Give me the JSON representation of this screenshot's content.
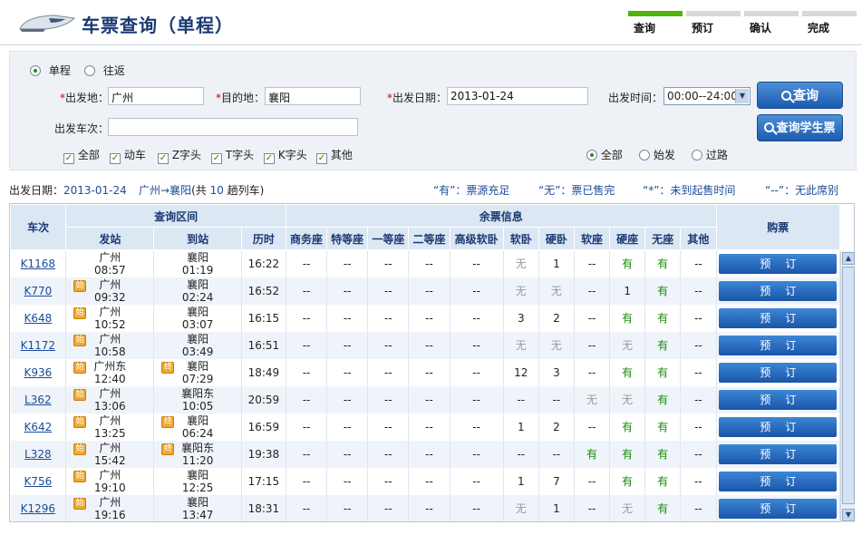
{
  "header": {
    "title": "车票查询（单程）",
    "steps": [
      "查询",
      "预订",
      "确认",
      "完成"
    ]
  },
  "search": {
    "trip_single": "单程",
    "trip_round": "往返",
    "from_label": "出发地：",
    "from_value": "广州",
    "to_label": "目的地：",
    "to_value": "襄阳",
    "date_label": "出发日期：",
    "date_value": "2013-01-24",
    "time_label": "出发时间：",
    "time_value": "00:00--24:00",
    "train_no_label": "出发车次：",
    "query_button": "查询",
    "student_button": "查询学生票",
    "train_types": [
      "全部",
      "动车",
      "Z字头",
      "T字头",
      "K字头",
      "其他"
    ],
    "station_filters": [
      "全部",
      "始发",
      "过路"
    ]
  },
  "summary": {
    "date_label": "出发日期：",
    "date": "2013-01-24",
    "route": "广州→襄阳",
    "count_pre": "(共 ",
    "count": "10",
    "count_post": " 趟列车)",
    "legend": [
      "“有”：票源充足",
      "“无”：票已售完",
      "“*”：未到起售时间",
      "“--”：无此席别"
    ]
  },
  "table": {
    "h_train": "车次",
    "h_section": "查询区间",
    "h_tickets": "余票信息",
    "h_buy": "购票",
    "h_from": "发站",
    "h_to": "到站",
    "h_dur": "历时",
    "seat_headers": [
      "商务座",
      "特等座",
      "一等座",
      "二等座",
      "高级软卧",
      "软卧",
      "硬卧",
      "软座",
      "硬座",
      "无座",
      "其他"
    ],
    "book_label": "预订",
    "rows": [
      {
        "train": "K1168",
        "from": "广州",
        "dep": "08:57",
        "to": "襄阳",
        "arr": "01:19",
        "dur": "16:22",
        "from_tag": "",
        "to_tag": "",
        "seats": [
          "--",
          "--",
          "--",
          "--",
          "--",
          "无",
          "1",
          "--",
          "有",
          "有",
          "--"
        ]
      },
      {
        "train": "K770",
        "from": "广州",
        "dep": "09:32",
        "to": "襄阳",
        "arr": "02:24",
        "dur": "16:52",
        "from_tag": "始",
        "to_tag": "",
        "seats": [
          "--",
          "--",
          "--",
          "--",
          "--",
          "无",
          "无",
          "--",
          "1",
          "有",
          "--"
        ]
      },
      {
        "train": "K648",
        "from": "广州",
        "dep": "10:52",
        "to": "襄阳",
        "arr": "03:07",
        "dur": "16:15",
        "from_tag": "始",
        "to_tag": "",
        "seats": [
          "--",
          "--",
          "--",
          "--",
          "--",
          "3",
          "2",
          "--",
          "有",
          "有",
          "--"
        ]
      },
      {
        "train": "K1172",
        "from": "广州",
        "dep": "10:58",
        "to": "襄阳",
        "arr": "03:49",
        "dur": "16:51",
        "from_tag": "始",
        "to_tag": "",
        "seats": [
          "--",
          "--",
          "--",
          "--",
          "--",
          "无",
          "无",
          "--",
          "无",
          "有",
          "--"
        ]
      },
      {
        "train": "K936",
        "from": "广州东",
        "dep": "12:40",
        "to": "襄阳",
        "arr": "07:29",
        "dur": "18:49",
        "from_tag": "始",
        "to_tag": "终",
        "seats": [
          "--",
          "--",
          "--",
          "--",
          "--",
          "12",
          "3",
          "--",
          "有",
          "有",
          "--"
        ]
      },
      {
        "train": "L362",
        "from": "广州",
        "dep": "13:06",
        "to": "襄阳东",
        "arr": "10:05",
        "dur": "20:59",
        "from_tag": "始",
        "to_tag": "",
        "seats": [
          "--",
          "--",
          "--",
          "--",
          "--",
          "--",
          "--",
          "无",
          "无",
          "有",
          "--"
        ]
      },
      {
        "train": "K642",
        "from": "广州",
        "dep": "13:25",
        "to": "襄阳",
        "arr": "06:24",
        "dur": "16:59",
        "from_tag": "始",
        "to_tag": "终",
        "seats": [
          "--",
          "--",
          "--",
          "--",
          "--",
          "1",
          "2",
          "--",
          "有",
          "有",
          "--"
        ]
      },
      {
        "train": "L328",
        "from": "广州",
        "dep": "15:42",
        "to": "襄阳东",
        "arr": "11:20",
        "dur": "19:38",
        "from_tag": "始",
        "to_tag": "终",
        "seats": [
          "--",
          "--",
          "--",
          "--",
          "--",
          "--",
          "--",
          "有",
          "有",
          "有",
          "--"
        ]
      },
      {
        "train": "K756",
        "from": "广州",
        "dep": "19:10",
        "to": "襄阳",
        "arr": "12:25",
        "dur": "17:15",
        "from_tag": "始",
        "to_tag": "",
        "seats": [
          "--",
          "--",
          "--",
          "--",
          "--",
          "1",
          "7",
          "--",
          "有",
          "有",
          "--"
        ]
      },
      {
        "train": "K1296",
        "from": "广州",
        "dep": "19:16",
        "to": "襄阳",
        "arr": "13:47",
        "dur": "18:31",
        "from_tag": "始",
        "to_tag": "",
        "seats": [
          "--",
          "--",
          "--",
          "--",
          "--",
          "无",
          "1",
          "--",
          "无",
          "有",
          "--"
        ]
      }
    ]
  },
  "colors": {
    "accent": "#1a5bb0",
    "available": "#1a8a0a",
    "soldout": "#9a9a9a",
    "step_active": "#4fb30a"
  },
  "icons": [
    "train-logo-icon",
    "search-icon",
    "scroll-up-icon",
    "scroll-down-icon",
    "dropdown-arrow-icon"
  ]
}
